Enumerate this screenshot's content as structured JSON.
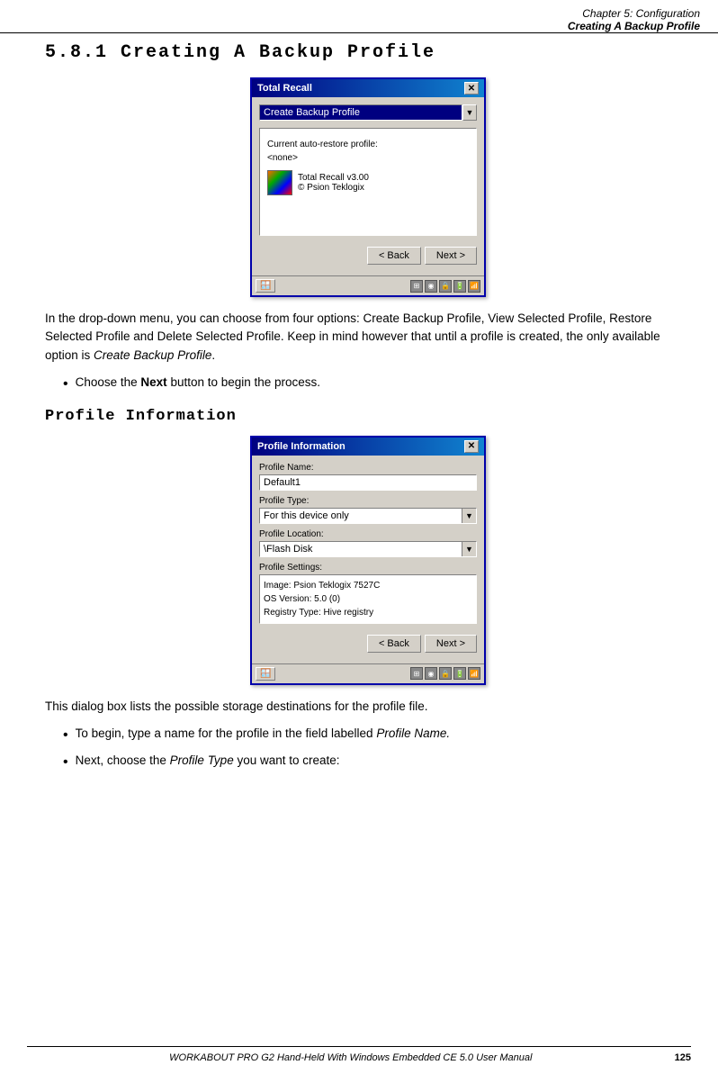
{
  "header": {
    "chapter": "Chapter  5:  Configuration",
    "section": "Creating A Backup Profile"
  },
  "section1": {
    "title": "5.8.1   Creating  A  Backup  Profile",
    "dialog1": {
      "title": "Total Recall",
      "dropdown_value": "Create Backup Profile",
      "content_line1": "Current auto-restore profile:",
      "content_line2": "<none>",
      "icon_line1": "Total Recall v3.00",
      "icon_line2": "© Psion Teklogix",
      "back_button": "< Back",
      "next_button": "Next >"
    },
    "para1": "In the drop-down menu, you can choose from four options: Create Backup Profile, View Selected Profile, Restore Selected Profile and Delete Selected Profile. Keep in mind however that until a profile is created, the only available option is Create Backup Profile.",
    "bullet1_prefix": "Choose the ",
    "bullet1_bold": "Next",
    "bullet1_suffix": " button to begin the process."
  },
  "section2": {
    "title": "Profile  Information",
    "dialog2": {
      "title": "Profile Information",
      "profile_name_label": "Profile Name:",
      "profile_name_value": "Default1",
      "profile_type_label": "Profile Type:",
      "profile_type_value": "For this device only",
      "profile_location_label": "Profile Location:",
      "profile_location_value": "\\Flash Disk",
      "profile_settings_label": "Profile Settings:",
      "settings_line1": "Image: Psion Teklogix 7527C",
      "settings_line2": "OS Version: 5.0 (0)",
      "settings_line3": "Registry Type: Hive registry",
      "back_button": "< Back",
      "next_button": "Next >"
    },
    "para2": "This dialog box lists the possible storage destinations for the profile file.",
    "bullet2_prefix": "To begin, type a name for the profile in the field labelled ",
    "bullet2_italic": "Profile Name.",
    "bullet3_prefix": "Next, choose the ",
    "bullet3_italic": "Profile Type",
    "bullet3_suffix": " you want to create:"
  },
  "footer": {
    "text": "WORKABOUT PRO G2 Hand-Held With Windows Embedded CE 5.0 User Manual",
    "page": "125"
  }
}
